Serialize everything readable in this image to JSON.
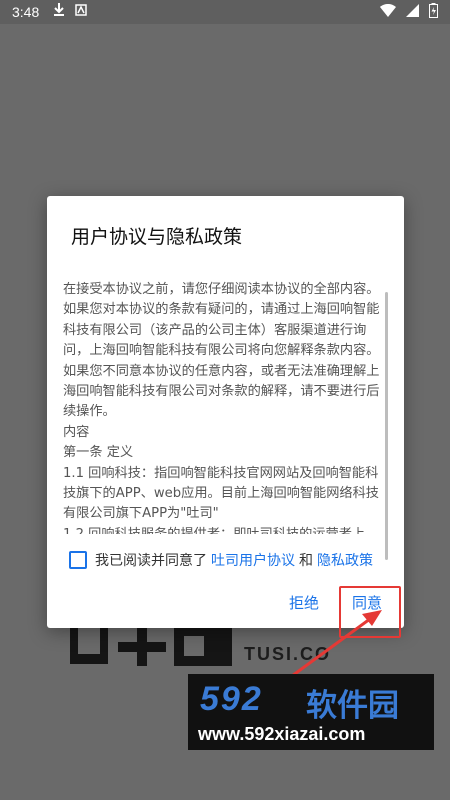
{
  "status_bar": {
    "time": "3:48"
  },
  "dialog": {
    "title": "用户协议与隐私政策",
    "content": [
      "在接受本协议之前，请您仔细阅读本协议的全部内容。如果您对本协议的条款有疑问的，请通过上海回响智能科技有限公司（该产品的公司主体）客服渠道进行询问，上海回响智能科技有限公司将向您解释条款内容。如果您不同意本协议的任意内容，或者无法准确理解上海回响智能科技有限公司对条款的解释，请不要进行后续操作。",
      " 内容",
      "第一条 定义",
      "1.1 回响科技：指回响智能科技官网网站及回响智能科技旗下的APP、web应用。目前上海回响智能网络科技有限公司旗下APP为\"吐司\"",
      "1.2 回响科技服务的提供者：即吐司科技的运营者上"
    ],
    "agree_prefix": "我已阅读并同意了",
    "user_agreement_link": "吐司用户协议",
    "and_text": "和",
    "privacy_link": "隐私政策",
    "reject_label": "拒绝",
    "agree_label": "同意"
  },
  "background": {
    "logo_sub": "TUSI.CO"
  },
  "watermark": {
    "number": "592",
    "name": "软件园",
    "url": "www.592xiazai.com"
  },
  "colors": {
    "accent": "#1a73e8",
    "annotation": "#e53935",
    "watermark_blue": "#3a7bd5"
  }
}
